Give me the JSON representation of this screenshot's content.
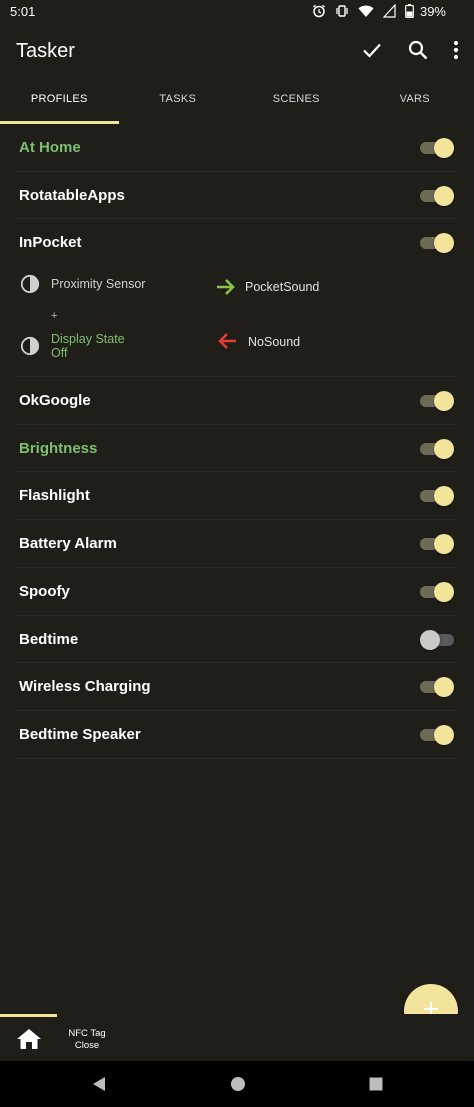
{
  "status": {
    "time": "5:01",
    "battery": "39%"
  },
  "app": {
    "title": "Tasker"
  },
  "tabs": [
    {
      "label": "PROFILES",
      "active": true
    },
    {
      "label": "TASKS",
      "active": false
    },
    {
      "label": "SCENES",
      "active": false
    },
    {
      "label": "VARS",
      "active": false
    }
  ],
  "profiles": [
    {
      "name": "At Home",
      "enabled": true,
      "active": true
    },
    {
      "name": "RotatableApps",
      "enabled": true,
      "active": false
    },
    {
      "name": "InPocket",
      "enabled": true,
      "active": false
    },
    {
      "name": "OkGoogle",
      "enabled": true,
      "active": false
    },
    {
      "name": "Brightness",
      "enabled": true,
      "active": true
    },
    {
      "name": "Flashlight",
      "enabled": true,
      "active": false
    },
    {
      "name": "Battery Alarm",
      "enabled": true,
      "active": false
    },
    {
      "name": "Spoofy",
      "enabled": true,
      "active": false
    },
    {
      "name": "Bedtime",
      "enabled": false,
      "active": false
    },
    {
      "name": "Wireless Charging",
      "enabled": true,
      "active": false
    },
    {
      "name": "Bedtime Speaker",
      "enabled": true,
      "active": false
    }
  ],
  "inpocket_detail": {
    "context1": "Proximity Sensor",
    "joiner": "+",
    "context2_line1": "Display State",
    "context2_line2": "Off",
    "enter_task": "PocketSound",
    "exit_task": "NoSound"
  },
  "bottom": {
    "tag_line1": "NFC Tag",
    "tag_line2": "Close"
  },
  "colors": {
    "accent": "#f2e49a",
    "active_green": "#7dbf6e",
    "enter_arrow": "#8bc34a",
    "exit_arrow": "#e53935",
    "background": "#201e19"
  }
}
